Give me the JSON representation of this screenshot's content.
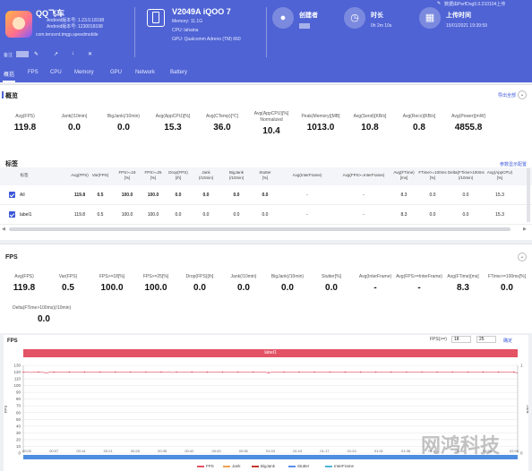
{
  "app": {
    "name": "QQ飞车",
    "android_line1": "Android版本号: 1.23.0.18198",
    "android_line2": "Android版本号: 1230018198",
    "package": "com.tencent.tmgp.speedmobile"
  },
  "device": {
    "name": "V2049A iQOO 7",
    "memory": "Memory: 11.1G",
    "cpu": "CPU: lahaina",
    "gpu": "GPU: Qualcomm Adreno (TM) 660"
  },
  "stats": {
    "creator_label": "创建者",
    "duration_label": "时长",
    "duration_value": "0h 2m 10s",
    "upload_label": "上传时间",
    "upload_value": "15/01/2021 19:39:59"
  },
  "top_right_text": "数据由PerfDog5.0.210104上传",
  "edit_label": "备注",
  "tabs": [
    "概括",
    "FPS",
    "CPU",
    "Memory",
    "GPU",
    "Network",
    "Battery"
  ],
  "overview": {
    "title": "概览",
    "export": "导出全部",
    "metrics": [
      {
        "label": "Avg(FPS)",
        "value": "119.8"
      },
      {
        "label": "Jank(/10min)",
        "value": "0.0"
      },
      {
        "label": "BigJank(/10min)",
        "value": "0.0"
      },
      {
        "label": "Avg(AppCPU)[%]",
        "value": "15.3"
      },
      {
        "label": "Avg(CTemp)[℃]",
        "value": "36.0"
      },
      {
        "label": "Avg(AppCPU)[%]\nNormalized",
        "value": "10.4"
      },
      {
        "label": "Peak(Memory)[MB]",
        "value": "1013.0"
      },
      {
        "label": "Avg(Send)[KB/s]",
        "value": "10.8"
      },
      {
        "label": "Avg(Recv)[KB/s]",
        "value": "0.8"
      },
      {
        "label": "Avg(Power)[mW]",
        "value": "4855.8"
      }
    ]
  },
  "labels_table": {
    "title": "标签",
    "right_link": "参数显示配置",
    "columns": [
      "标签",
      "Avg(FPS)",
      "Var(FPS)",
      "FPS>=18\n[%]",
      "FPS>=25\n[%]",
      "Drop(FPS)\n[/h]",
      "Jank\n(/10min)",
      "BigJank\n(/10min)",
      "Stutter\n[%]",
      "Avg(InterFrame)",
      "Avg(FPS>=InterFrame)",
      "Avg(FTime)\n[ms]",
      "FTime>=100ms\n[%]",
      "Delta(FTime>100ms\n(/10min)",
      "Avg(AppCPU)\n[%]"
    ],
    "rows": [
      [
        "All",
        "119.8",
        "0.5",
        "100.0",
        "100.0",
        "0.0",
        "0.0",
        "0.0",
        "0.0",
        "-",
        "-",
        "8.3",
        "0.0",
        "0.0",
        "15.3"
      ],
      [
        "label1",
        "119.8",
        "0.5",
        "100.0",
        "100.0",
        "0.0",
        "0.0",
        "0.0",
        "0.0",
        "-",
        "-",
        "8.3",
        "0.0",
        "0.0",
        "15.3"
      ]
    ]
  },
  "fps_section": {
    "title": "FPS",
    "metrics_row1": [
      {
        "label": "Avg(FPS)",
        "value": "119.8"
      },
      {
        "label": "Var(FPS)",
        "value": "0.5"
      },
      {
        "label": "FPS>=18[%]",
        "value": "100.0"
      },
      {
        "label": "FPS>=25[%]",
        "value": "100.0"
      },
      {
        "label": "Drop(FPS)[/h]",
        "value": "0.0"
      },
      {
        "label": "Jank(/10min)",
        "value": "0.0"
      },
      {
        "label": "BigJank(/10min)",
        "value": "0.0"
      },
      {
        "label": "Stutter[%]",
        "value": "0.0"
      },
      {
        "label": "Avg(InterFrame)",
        "value": "-"
      },
      {
        "label": "Avg(FPS>=InterFrame)",
        "value": "-"
      },
      {
        "label": "Avg(FTime)[ms]",
        "value": "8.3"
      },
      {
        "label": "FTime>=100ms[%]",
        "value": "0.0"
      }
    ],
    "metrics_row2": [
      {
        "label": "Delta(FTime>100ms)(/10min)",
        "value": "0.0"
      }
    ]
  },
  "fps_chart": {
    "title": "FPS",
    "filter_label": "FPS(>=)",
    "filter_a": "18",
    "filter_b": "25",
    "filter_link": "确定",
    "tag": "label1",
    "y_left_label": "FPS",
    "y_right_label": "Jank",
    "legend": [
      {
        "name": "FPS",
        "color": "#e45265"
      },
      {
        "name": "Jank",
        "color": "#f0a050"
      },
      {
        "name": "BigJank",
        "color": "#c0392b"
      },
      {
        "name": "Stutter",
        "color": "#5b8def"
      },
      {
        "name": "InterFrame",
        "color": "#4fb4d8"
      }
    ]
  },
  "chart_data": {
    "type": "line",
    "title": "FPS",
    "ylabel": "FPS",
    "y2label": "Jank",
    "ylim": [
      0,
      130
    ],
    "yticks": [
      0,
      10,
      20,
      30,
      40,
      50,
      60,
      70,
      80,
      90,
      100,
      110,
      120,
      130
    ],
    "y2ticks": [
      0,
      1
    ],
    "xticks": [
      "00:00",
      "00:07",
      "00:14",
      "00:21",
      "00:28",
      "00:35",
      "00:42",
      "00:49",
      "00:56",
      "01:03",
      "01:10",
      "01:17",
      "01:24",
      "01:31",
      "01:38",
      "01:45",
      "01:52",
      "01:59",
      "02:06"
    ],
    "series": [
      {
        "name": "FPS",
        "values": [
          120,
          120,
          119.5,
          120,
          120,
          120,
          118.5,
          120,
          120,
          120,
          120,
          120,
          120,
          120,
          120,
          120,
          120,
          120,
          120,
          120,
          120,
          120,
          120,
          120,
          120,
          120,
          120,
          120,
          120,
          120,
          120,
          120,
          120,
          120,
          120,
          120,
          120,
          120,
          120,
          119.5,
          120,
          120,
          120,
          120,
          120,
          120,
          120,
          120,
          120,
          120,
          120,
          120,
          120,
          120,
          120,
          120,
          120,
          120,
          120,
          120,
          120,
          120,
          120,
          120,
          119,
          120,
          120,
          120,
          120,
          120,
          120,
          120,
          120,
          120,
          120,
          120,
          120,
          120,
          120,
          120,
          120,
          120,
          120,
          120,
          120,
          120,
          120,
          120,
          120,
          120,
          120,
          120,
          120,
          120,
          120,
          120,
          120,
          120,
          120,
          120,
          120,
          120,
          120,
          120,
          120,
          120,
          120,
          120,
          120,
          120,
          120,
          120,
          120,
          120,
          120,
          120,
          120,
          120,
          120,
          120,
          120,
          120,
          120,
          120,
          120,
          120,
          120,
          120,
          120,
          118.5
        ]
      },
      {
        "name": "Jank",
        "values": []
      },
      {
        "name": "BigJank",
        "values": []
      },
      {
        "name": "Stutter",
        "values": []
      },
      {
        "name": "InterFrame",
        "values": []
      }
    ]
  },
  "watermark": "网鸿科技"
}
